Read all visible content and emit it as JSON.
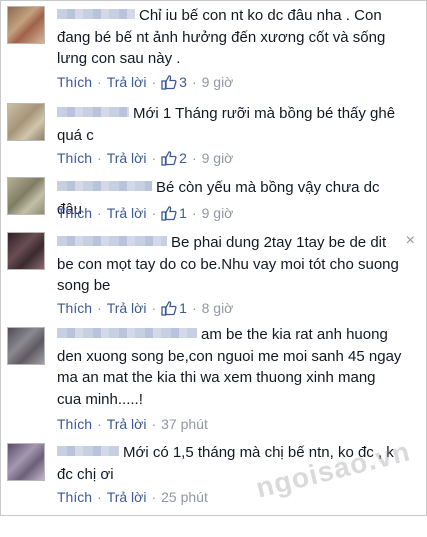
{
  "comments": [
    {
      "text": "Chỉ iu bế con nt ko dc đâu nha . Con đang bé bế nt ảnh hưởng đến xương cốt và sống lưng con sau này .",
      "like_label": "Thích",
      "reply_label": "Trả lời",
      "likes": "3",
      "time": "9 giờ",
      "avatar_color": "#a57a5d"
    },
    {
      "text": "Mới 1 Tháng rưỡi mà bồng bé thấy ghê quá c",
      "like_label": "Thích",
      "reply_label": "Trả lời",
      "likes": "2",
      "time": "9 giờ",
      "avatar_color": "#b7a58c"
    },
    {
      "text": "Bé còn yếu mà bồng vậy chưa dc đâu",
      "like_label": "Thích",
      "reply_label": "Trả lời",
      "likes": "1",
      "time": "9 giờ",
      "avatar_color": "#9c9c7d"
    },
    {
      "text": "Be phai dung 2tay 1tay be de dit be con mọt tay do co be.Nhu vay moi tót cho suong song be",
      "like_label": "Thích",
      "reply_label": "Trả lời",
      "likes": "1",
      "time": "8 giờ",
      "avatar_color": "#4d3a3f"
    },
    {
      "text": "am be the kia rat anh huong den xuong song be,con nguoi me moi sanh 45 ngay ma an mat the kia thi wa xem thuong xinh mang cua minh.....!",
      "like_label": "Thích",
      "reply_label": "Trả lời",
      "likes": "",
      "time": "37 phút",
      "avatar_color": "#6c6a70"
    },
    {
      "text": "Mới có 1,5 tháng mà chị bế ntn, ko đc , k đc chị ơi",
      "like_label": "Thích",
      "reply_label": "Trả lời",
      "likes": "",
      "time": "25 phút",
      "avatar_color": "#7b6f82"
    }
  ],
  "close_icon": "×",
  "watermark_text": "ngoisao.vn",
  "colors": {
    "link": "#3b5998",
    "meta": "#9197a3",
    "text": "#141823"
  }
}
